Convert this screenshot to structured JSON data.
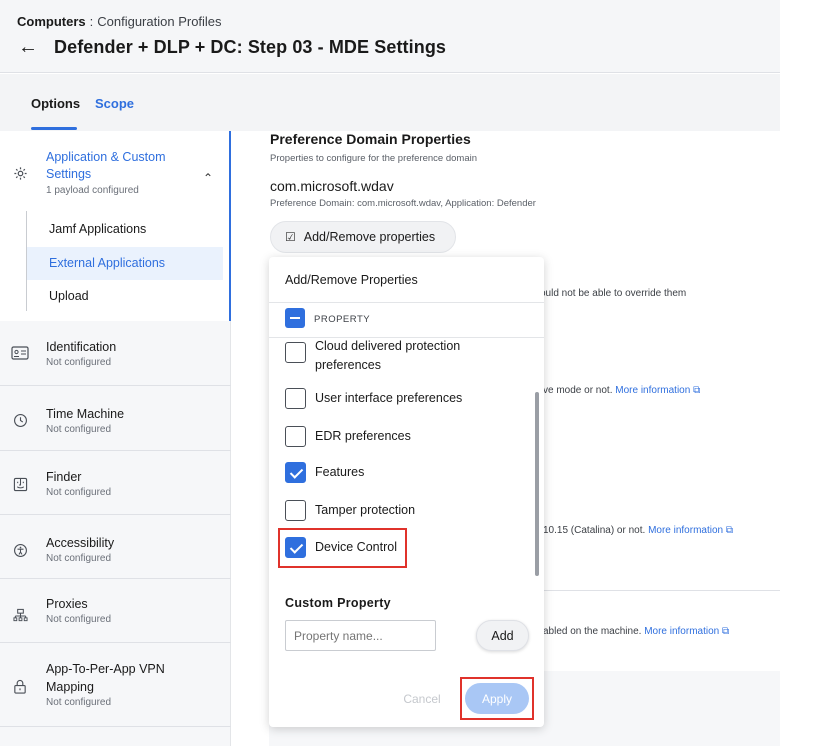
{
  "breadcrumb": {
    "section": "Computers",
    "separator": ":",
    "page": "Configuration Profiles"
  },
  "header": {
    "title": "Defender + DLP + DC: Step 03 - MDE Settings"
  },
  "tabs": [
    {
      "label": "Options"
    },
    {
      "label": "Scope"
    }
  ],
  "sidebar": {
    "payload": {
      "label": "Application & Custom Settings",
      "label_line1": "Application & Custom",
      "label_line2": "Settings",
      "status": "1 payload configured"
    },
    "subitems": [
      {
        "label": "Jamf Applications"
      },
      {
        "label": "External Applications"
      },
      {
        "label": "Upload"
      }
    ],
    "items": [
      {
        "label": "Identification",
        "status": "Not configured"
      },
      {
        "label": "Time Machine",
        "status": "Not configured"
      },
      {
        "label": "Finder",
        "status": "Not configured"
      },
      {
        "label": "Accessibility",
        "status": "Not configured"
      },
      {
        "label": "Proxies",
        "status": "Not configured"
      },
      {
        "label_line1": "App-To-Per-App VPN",
        "label_line2": "Mapping",
        "status": "Not configured"
      }
    ]
  },
  "content": {
    "section_title": "Preference Domain Properties",
    "section_subtitle": "Properties to configure for the preference domain",
    "domain": "com.microsoft.wdav",
    "domain_desc": "Preference Domain: com.microsoft.wdav, Application: Defender",
    "add_remove_label": "Add/Remove properties",
    "bg_lines": [
      {
        "text": "ould not be able to override them",
        "link": ""
      },
      {
        "text": "ve mode or not. ",
        "link": "More information"
      },
      {
        "text": "10.15 (Catalina) or not. ",
        "link": "More information"
      },
      {
        "text": "abled on the machine. ",
        "link": "More information"
      }
    ]
  },
  "popup": {
    "title": "Add/Remove Properties",
    "header_label": "PROPERTY",
    "options": [
      {
        "line1": "Cloud delivered protection",
        "line2": "preferences",
        "checked": false
      },
      {
        "line1": "User interface preferences",
        "checked": false
      },
      {
        "line1": "EDR preferences",
        "checked": false
      },
      {
        "line1": "Features",
        "checked": true
      },
      {
        "line1": "Tamper protection",
        "checked": false
      },
      {
        "line1": "Device Control",
        "checked": true
      }
    ],
    "custom_title": "Custom Property",
    "custom_placeholder": "Property name...",
    "add_label": "Add",
    "cancel_label": "Cancel",
    "apply_label": "Apply"
  },
  "colors": {
    "accent": "#2f6fde",
    "highlight": "#e0322b",
    "apply_disabled": "#a9c7f5"
  }
}
